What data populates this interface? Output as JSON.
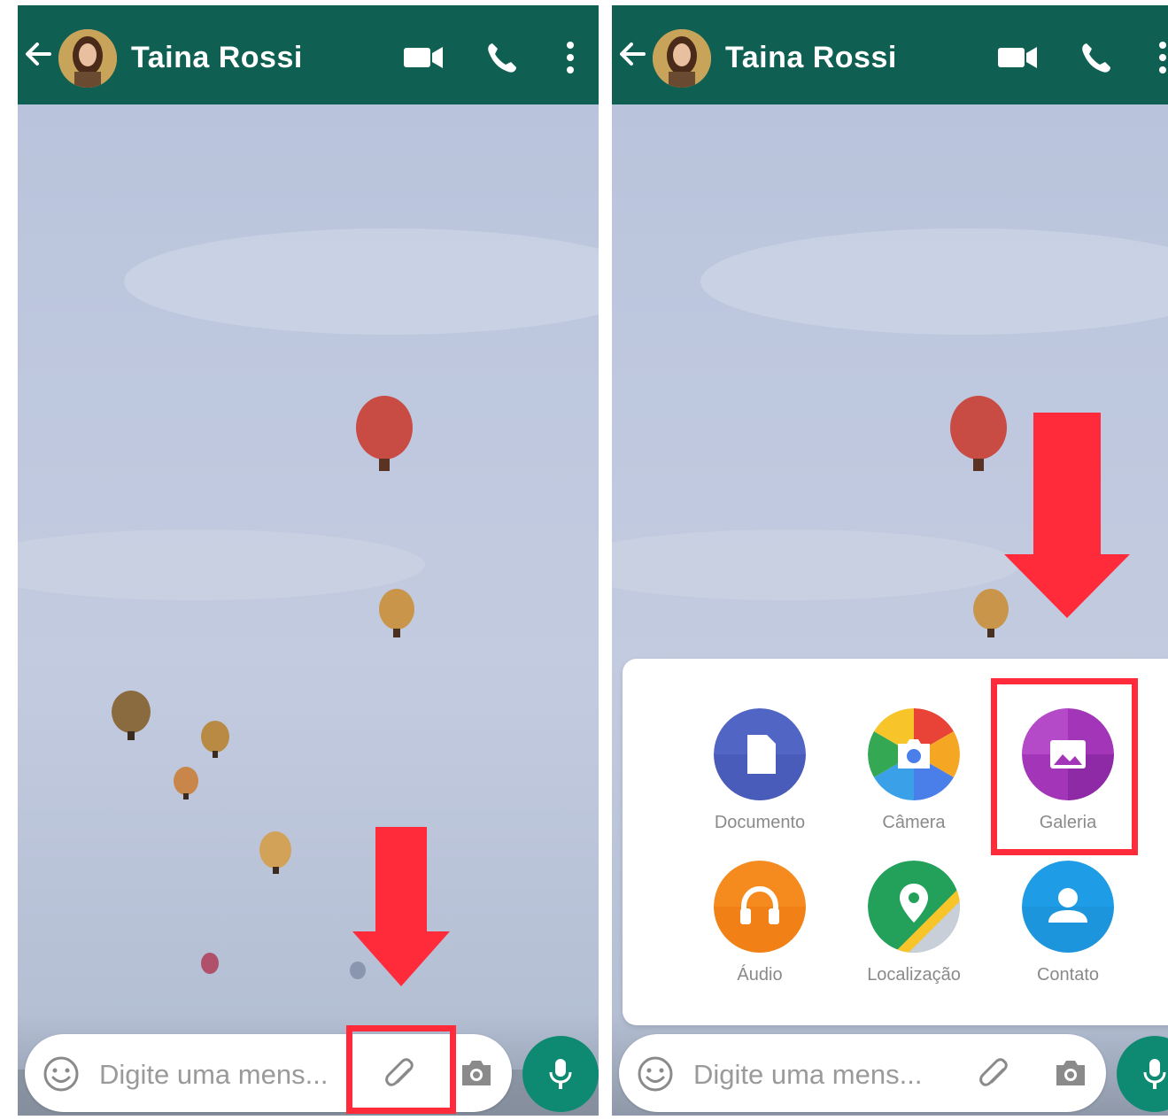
{
  "chat": {
    "contact_name": "Taina Rossi",
    "input_placeholder": "Digite uma mens..."
  },
  "attach_menu": {
    "items": [
      {
        "label": "Documento",
        "icon": "document-icon",
        "color": "#5165c4"
      },
      {
        "label": "Câmera",
        "icon": "camera-icon",
        "color": "#f0a020"
      },
      {
        "label": "Galeria",
        "icon": "gallery-icon",
        "color": "#a235b8"
      },
      {
        "label": "Áudio",
        "icon": "headphones-icon",
        "color": "#f58a1f"
      },
      {
        "label": "Localização",
        "icon": "location-icon",
        "color": "#23a05a"
      },
      {
        "label": "Contato",
        "icon": "contact-icon",
        "color": "#1e9de6"
      }
    ]
  },
  "colors": {
    "header": "#0f5f52",
    "mic_button": "#0f8a72",
    "highlight": "#ff2a3a"
  }
}
